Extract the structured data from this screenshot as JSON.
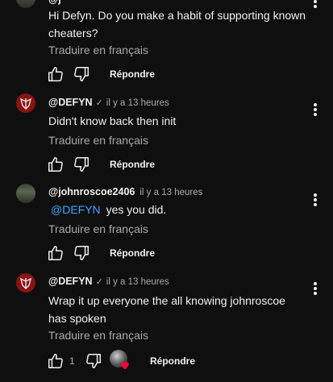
{
  "top_comment": {
    "author_partial": "@j",
    "text": "Hi Defyn. Do you make a habit of supporting known cheaters?",
    "translate": "Traduire en français",
    "reply": "Répondre"
  },
  "comments": [
    {
      "author": "@DEFYN",
      "verified": "✓",
      "time": "il y a 13 heures",
      "text": "Didn't know back then init",
      "translate": "Traduire en français",
      "reply": "Répondre"
    },
    {
      "author": "@johnroscoe2406",
      "time": "il y a 13 heures",
      "mention": "@DEFYN",
      "text": "yes you did.",
      "translate": "Traduire en français",
      "reply": "Répondre"
    },
    {
      "author": "@DEFYN",
      "verified": "✓",
      "time": "il y a 13 heures",
      "text": "Wrap it up everyone the all knowing johnroscoe has spoken",
      "translate": "Traduire en français",
      "like_count": "1",
      "reply": "Répondre"
    }
  ],
  "icons": {
    "like": "thumbs-up-icon",
    "dislike": "thumbs-down-icon",
    "more": "more-vert-icon",
    "creator_heart": "heart-icon"
  },
  "colors": {
    "background": "#0f0f0f",
    "text": "#f1f1f1",
    "secondary": "#aaaaaa",
    "link": "#3ea6ff",
    "heart": "#ff0033"
  }
}
